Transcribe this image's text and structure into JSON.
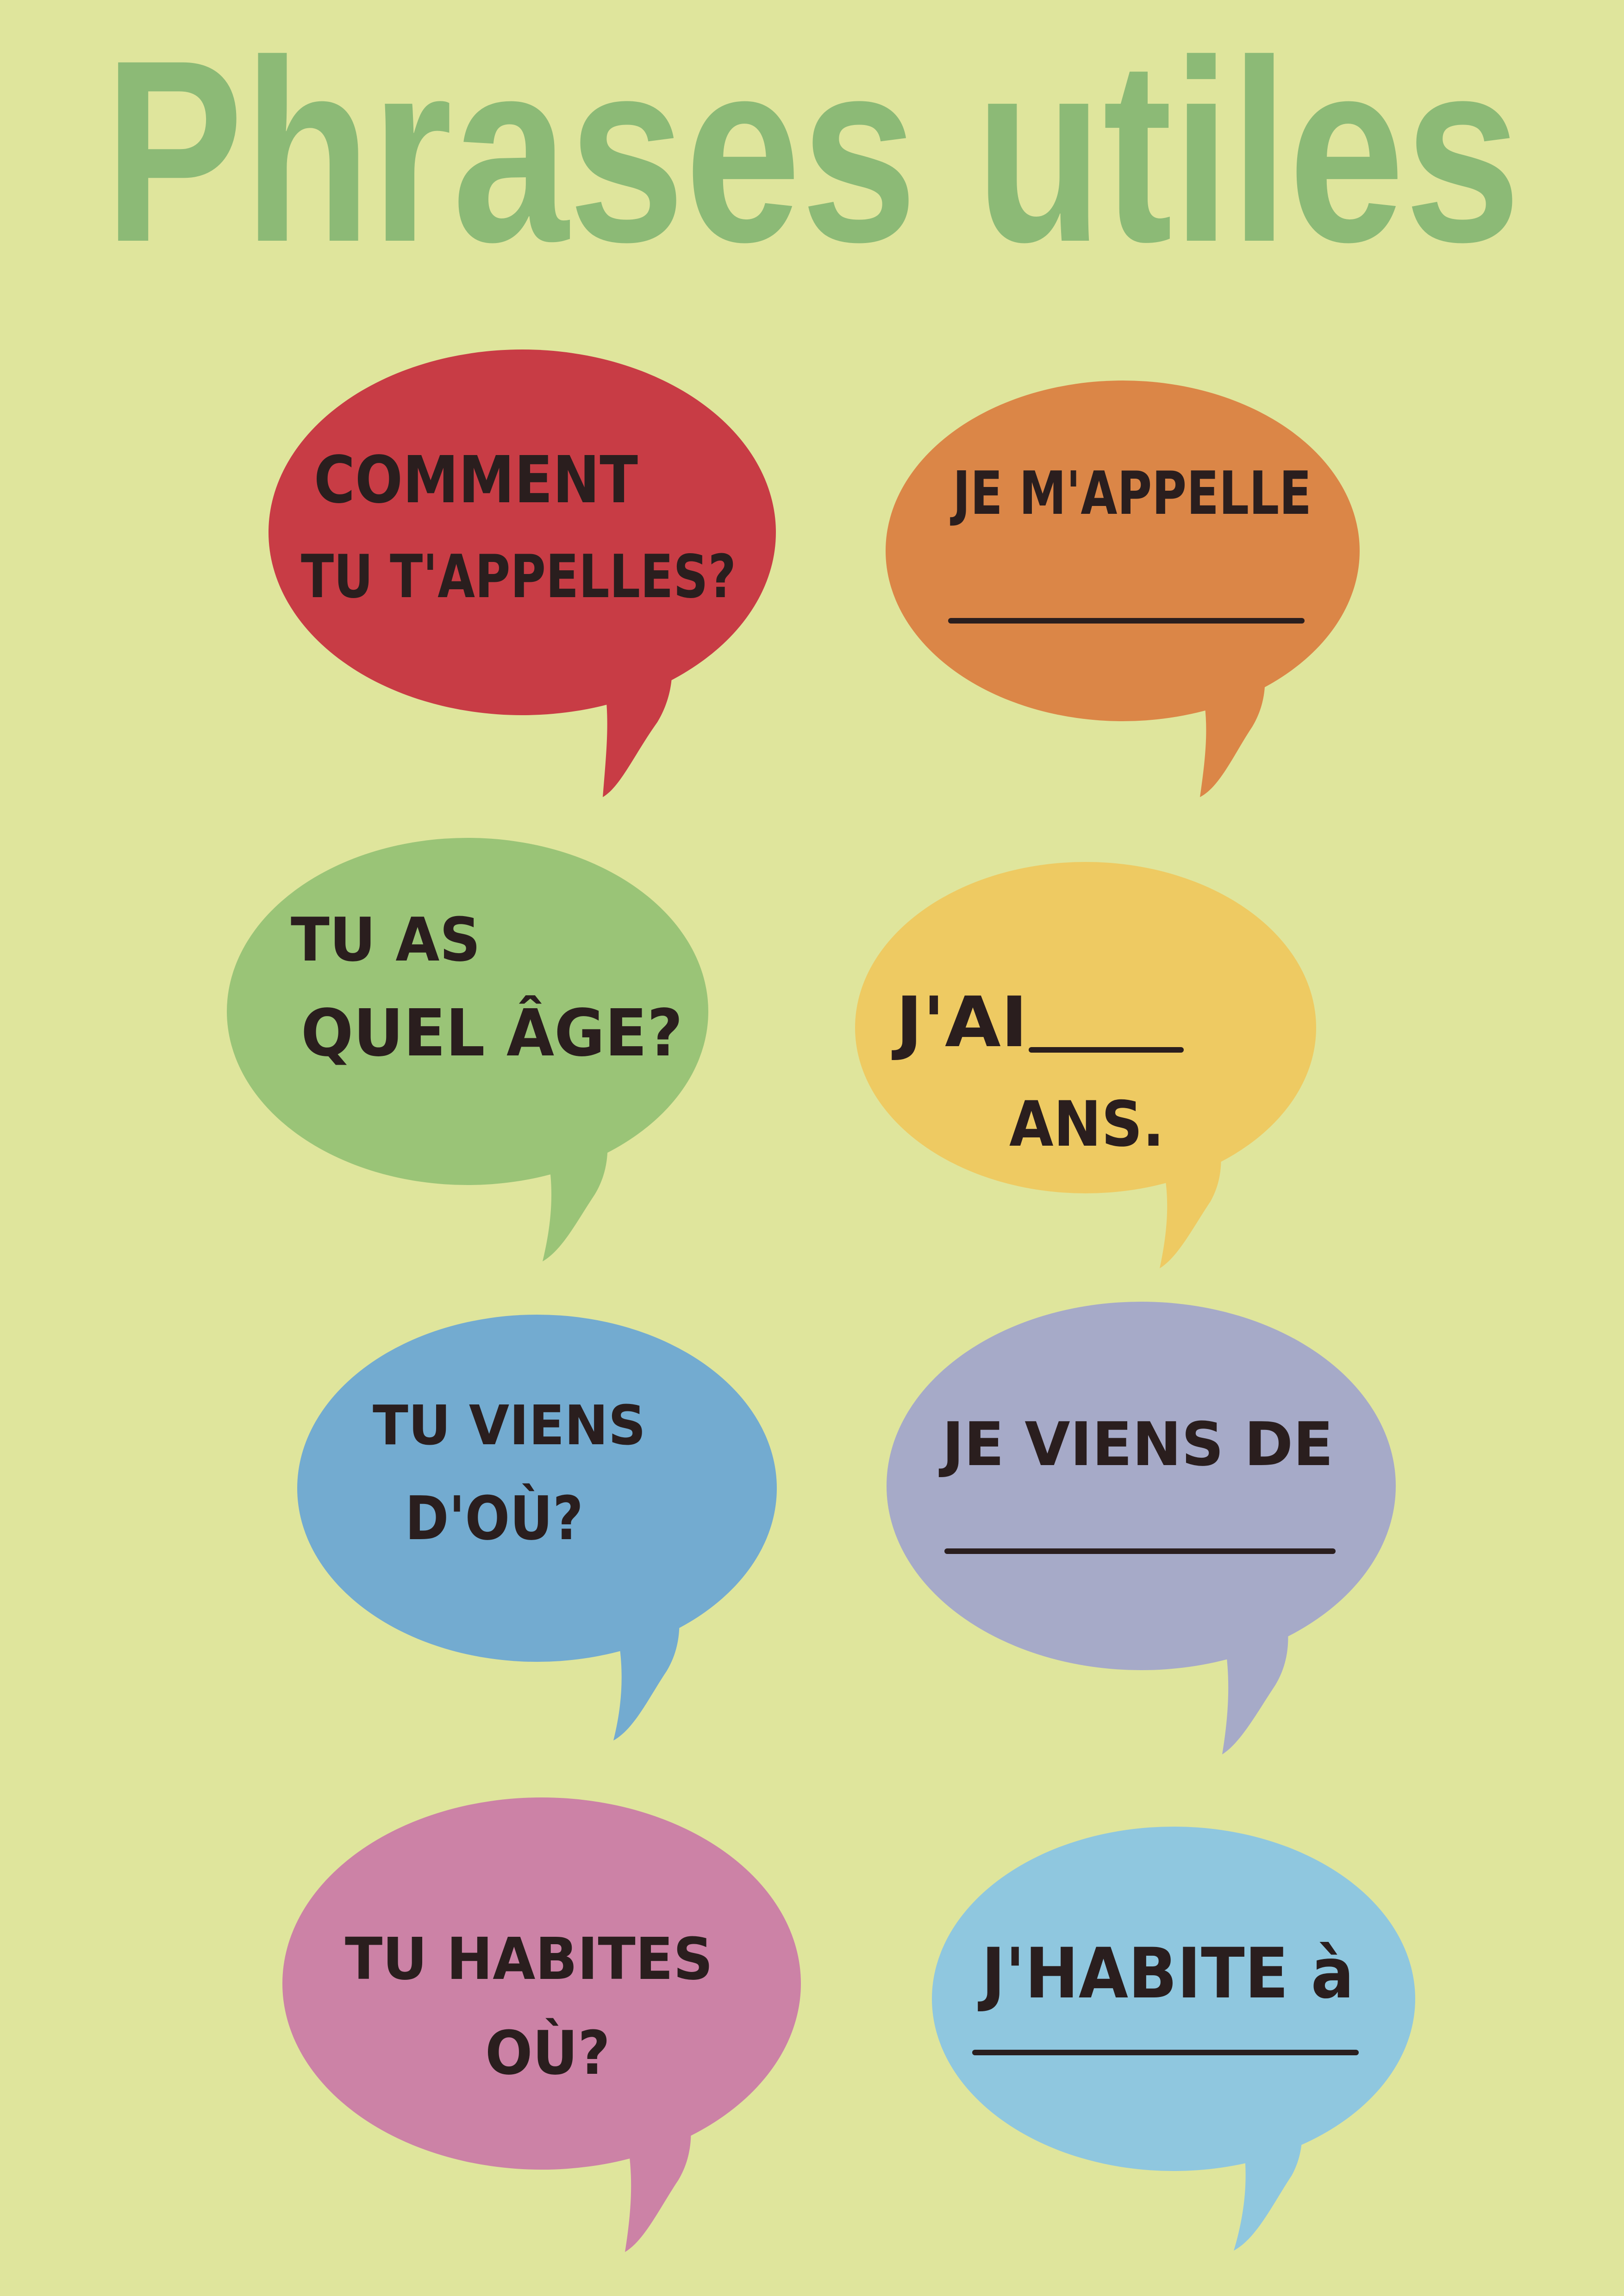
{
  "title": "Phrases utiles",
  "colors": {
    "background": "#dfe59c",
    "title": "#8cba76",
    "text": "#2a1e1e"
  },
  "bubbles": [
    {
      "id": "q1",
      "color": "#c83c45",
      "lines": [
        "COMMENT",
        "TU T'APPELLES?"
      ]
    },
    {
      "id": "a1",
      "color": "#db8647",
      "lines": [
        "JE M'APPELLE"
      ],
      "blank": true
    },
    {
      "id": "q2",
      "color": "#9ac477",
      "lines": [
        "TU AS",
        "QUEL ÂGE?"
      ]
    },
    {
      "id": "a2",
      "color": "#eeca62",
      "lines": [
        "J'AI",
        "ANS."
      ],
      "blank": true
    },
    {
      "id": "q3",
      "color": "#73abd0",
      "lines": [
        "TU VIENS",
        "D'OÙ?"
      ]
    },
    {
      "id": "a3",
      "color": "#a6aac8",
      "lines": [
        "JE VIENS DE"
      ],
      "blank": true
    },
    {
      "id": "q4",
      "color": "#cc82a6",
      "lines": [
        "TU HABITES",
        "OÙ?"
      ]
    },
    {
      "id": "a4",
      "color": "#8fc7df",
      "lines": [
        "J'HABITE à"
      ],
      "blank": true
    }
  ]
}
